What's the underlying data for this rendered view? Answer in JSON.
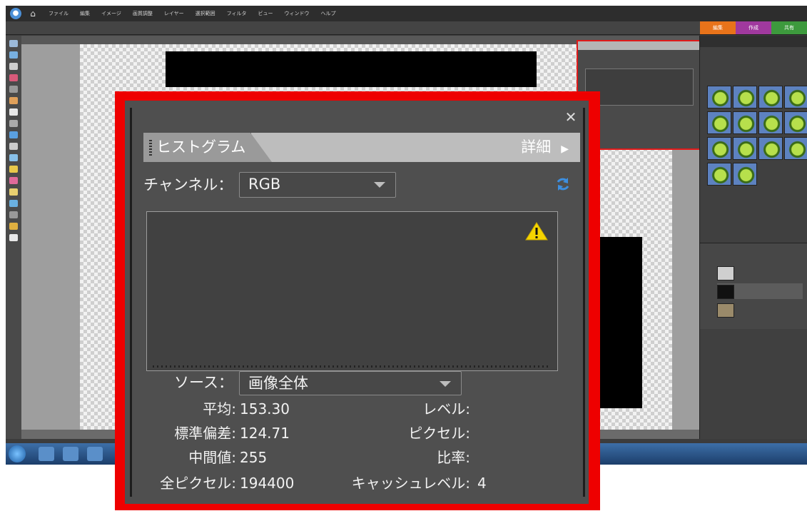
{
  "background_app": {
    "menu": [
      "ファイル",
      "編集",
      "イメージ",
      "画質調整",
      "レイヤー",
      "選択範囲",
      "フィルタ",
      "ビュー",
      "ウィンドウ",
      "ヘルプ"
    ],
    "right_tabs": [
      "編集",
      "作成",
      "共有"
    ]
  },
  "histogram_panel": {
    "tab_label": "ヒストグラム",
    "detail_label": "詳細",
    "channel_label": "チャンネル：",
    "channel_value": "RGB",
    "source_label": "ソース：",
    "source_value": "画像全体",
    "stats": {
      "mean_label": "平均:",
      "mean_value": "153.30",
      "stddev_label": "標準偏差:",
      "stddev_value": "124.71",
      "median_label": "中間値:",
      "median_value": "255",
      "pixels_label": "全ピクセル:",
      "pixels_value": "194400",
      "level_label": "レベル:",
      "count_label": "ピクセル:",
      "percentile_label": "比率:",
      "cache_label": "キャッシュレベル:",
      "cache_value": "4"
    }
  },
  "colors": {
    "highlight": "#ee0000",
    "refresh_icon": "#3d8fe0",
    "warning_icon": "#f5d400"
  },
  "icons": [
    "close-icon",
    "tab-grip-icon",
    "chevron-right-icon",
    "dropdown-arrow-icon",
    "refresh-icon",
    "warning-icon"
  ]
}
